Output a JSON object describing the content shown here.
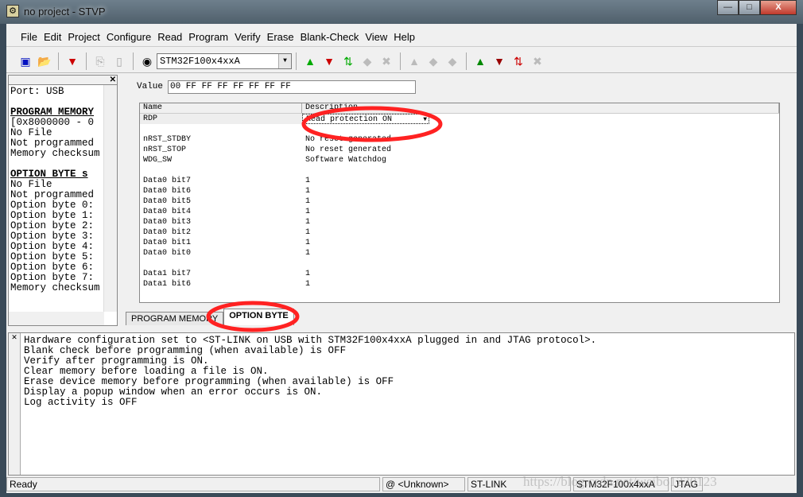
{
  "window": {
    "title": "no project - STVP",
    "min": "—",
    "max": "□",
    "close": "X"
  },
  "menu": [
    "File",
    "Edit",
    "Project",
    "Configure",
    "Read",
    "Program",
    "Verify",
    "Erase",
    "Blank-Check",
    "View",
    "Help"
  ],
  "toolbar": {
    "device": "STM32F100x4xxA"
  },
  "left_panel": {
    "lines": [
      {
        "t": "Port: USB",
        "h": false
      },
      {
        "t": "",
        "h": false
      },
      {
        "t": "PROGRAM MEMORY",
        "h": true
      },
      {
        "t": "[0x8000000 - 0",
        "h": false
      },
      {
        "t": "No File",
        "h": false
      },
      {
        "t": "Not programmed",
        "h": false
      },
      {
        "t": "Memory checksum",
        "h": false
      },
      {
        "t": "",
        "h": false
      },
      {
        "t": "OPTION BYTE s",
        "h": true
      },
      {
        "t": "No File",
        "h": false
      },
      {
        "t": "Not programmed",
        "h": false
      },
      {
        "t": "Option byte 0:",
        "h": false
      },
      {
        "t": "Option byte 1:",
        "h": false
      },
      {
        "t": "Option byte 2:",
        "h": false
      },
      {
        "t": "Option byte 3:",
        "h": false
      },
      {
        "t": "Option byte 4:",
        "h": false
      },
      {
        "t": "Option byte 5:",
        "h": false
      },
      {
        "t": "Option byte 6:",
        "h": false
      },
      {
        "t": "Option byte 7:",
        "h": false
      },
      {
        "t": "Memory checksum",
        "h": false
      }
    ]
  },
  "value": {
    "label": "Value",
    "text": "00 FF FF FF FF FF FF FF"
  },
  "table": {
    "headers": [
      "Name",
      "Description"
    ],
    "rows": [
      [
        "RDP",
        "Read protection ON"
      ],
      [
        "",
        ""
      ],
      [
        "nRST_STDBY",
        "No reset generated"
      ],
      [
        "nRST_STOP",
        "No reset generated"
      ],
      [
        "WDG_SW",
        "Software Watchdog"
      ],
      [
        "",
        ""
      ],
      [
        "Data0 bit7",
        "1"
      ],
      [
        "Data0 bit6",
        "1"
      ],
      [
        "Data0 bit5",
        "1"
      ],
      [
        "Data0 bit4",
        "1"
      ],
      [
        "Data0 bit3",
        "1"
      ],
      [
        "Data0 bit2",
        "1"
      ],
      [
        "Data0 bit1",
        "1"
      ],
      [
        "Data0 bit0",
        "1"
      ],
      [
        "",
        ""
      ],
      [
        "Data1 bit7",
        "1"
      ],
      [
        "Data1 bit6",
        "1"
      ]
    ]
  },
  "tabs": [
    "PROGRAM MEMORY",
    "OPTION BYTE"
  ],
  "log": [
    "Hardware configuration set to <ST-LINK on USB with STM32F100x4xxA plugged in and JTAG protocol>.",
    "Blank check before programming (when available) is OFF",
    "Verify after programming is ON.",
    "Clear memory before loading a file is ON.",
    "Erase device memory before programming (when available) is OFF",
    "Display a popup window when an error occurs is ON.",
    "Log activity is OFF"
  ],
  "status": {
    "ready": "Ready",
    "address": "@ <Unknown>",
    "tool": "ST-LINK",
    "device": "STM32F100x4xxA",
    "protocol": "JTAG"
  },
  "watermark": "https://blog.csdn.net/weibo1230123"
}
